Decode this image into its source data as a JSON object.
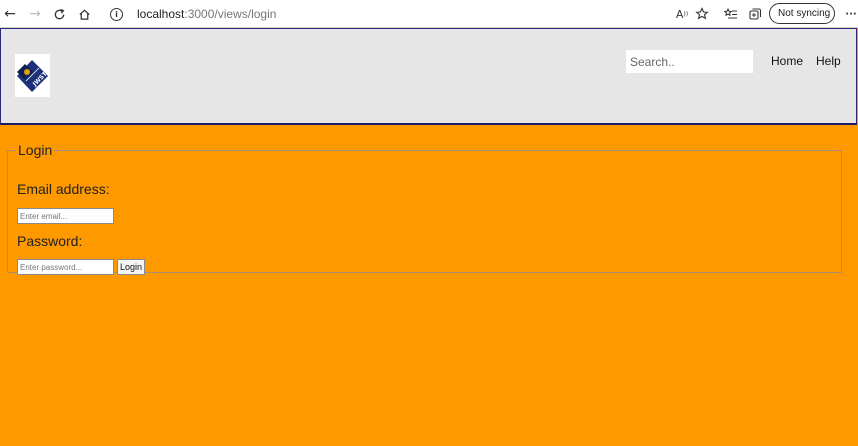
{
  "browser": {
    "url_host": "localhost",
    "url_rest": ":3000/views/login",
    "sync_label": "Not syncing",
    "more_label": "···"
  },
  "header": {
    "logo_text": "JWST",
    "search": {
      "placeholder": "Search..",
      "value": ""
    },
    "nav": {
      "home": "Home",
      "help": "Help"
    }
  },
  "login": {
    "legend": "Login",
    "email_label": "Email address:",
    "email_placeholder": "Enter email...",
    "password_label": "Password:",
    "password_placeholder": "Enter password...",
    "button_label": "Login"
  },
  "colors": {
    "page_bg": "#ff9900",
    "header_bg": "#e6e6e6",
    "header_border": "#1a1a66"
  }
}
